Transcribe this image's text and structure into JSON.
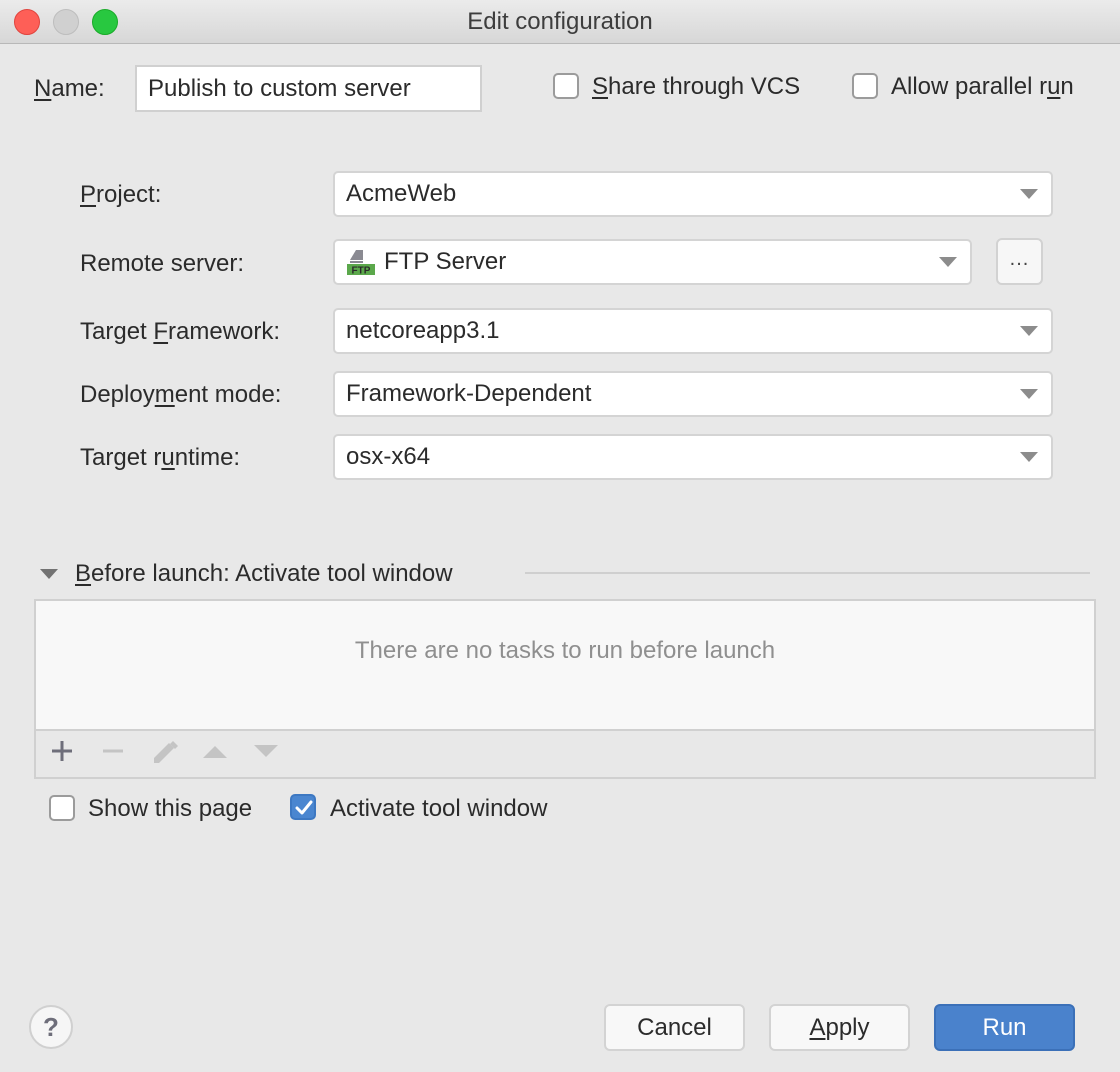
{
  "window": {
    "title": "Edit configuration"
  },
  "name_row": {
    "label_mnemonic": "N",
    "label_rest": "ame:",
    "value": "Publish to custom server",
    "share_vcs": {
      "mnemonic": "S",
      "rest": "hare through VCS",
      "checked": false
    },
    "parallel_run": {
      "pre": "Allow parallel r",
      "mnemonic": "u",
      "rest": "n",
      "checked": false
    }
  },
  "form": {
    "project": {
      "label_pre": "",
      "label_mn": "P",
      "label_post": "roject:",
      "value": "AcmeWeb"
    },
    "remote_server": {
      "label": "Remote server:",
      "value": "FTP Server",
      "icon": "ftp-server-icon",
      "icon_text": "FTP",
      "browse_label": "..."
    },
    "target_framework": {
      "label_pre": "Target ",
      "label_mn": "F",
      "label_post": "ramework:",
      "value": "netcoreapp3.1"
    },
    "deployment_mode": {
      "label_pre": "Deploy",
      "label_mn": "m",
      "label_post": "ent mode:",
      "value": "Framework-Dependent"
    },
    "target_runtime": {
      "label_pre": "Target r",
      "label_mn": "u",
      "label_post": "ntime:",
      "value": "osx-x64"
    }
  },
  "before_launch": {
    "title_mn": "B",
    "title_rest": "efore launch: Activate tool window",
    "empty_message": "There are no tasks to run before launch",
    "toolbar": [
      "add-icon",
      "remove-icon",
      "edit-icon",
      "move-up-icon",
      "move-down-icon"
    ]
  },
  "options": {
    "show_this_page": {
      "label": "Show this page",
      "checked": false
    },
    "activate_tool_window": {
      "label": "Activate tool window",
      "checked": true
    }
  },
  "buttons": {
    "help": "?",
    "cancel": "Cancel",
    "apply_mn": "A",
    "apply_rest": "pply",
    "run": "Run"
  },
  "colors": {
    "primary": "#4a82cc",
    "checkbox_checked": "#4a86d0",
    "ftp_green": "#5ba84b"
  }
}
